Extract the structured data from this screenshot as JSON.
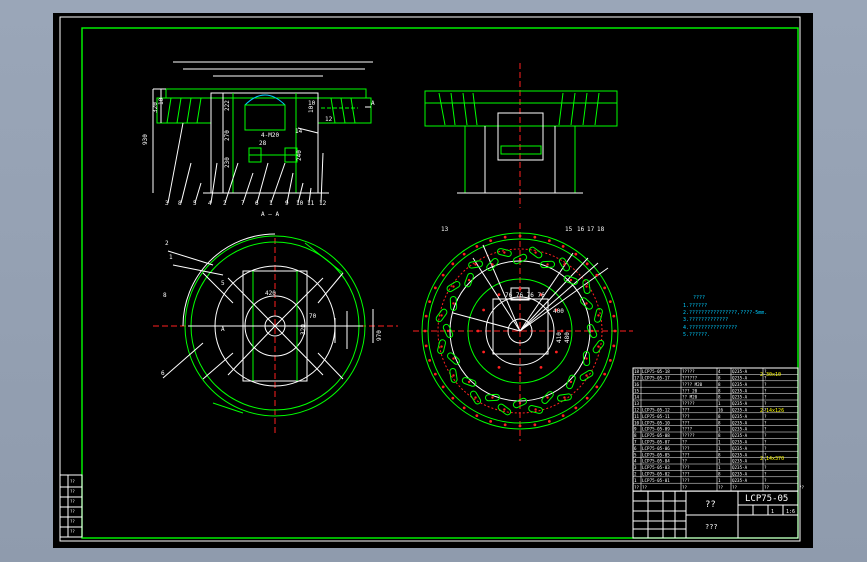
{
  "colors": {
    "canvas": "#000000",
    "viewport": "#96a2b4",
    "frame": "#ffffff",
    "border": "#00ff00",
    "part": "#ffffff",
    "green": "#00ff00",
    "red": "#ff2020",
    "cyan": "#00ccff",
    "yellow": "#ffff00",
    "magenta": "#ff00ff"
  },
  "section_views": {
    "section_label": "A – A",
    "cut_mark_left": "A",
    "cut_mark_right": "A",
    "dims": {
      "overall_height": "930",
      "top_band": "320",
      "upper_offset": "10",
      "inner_height": "222",
      "side_a": "270",
      "side_b": "230",
      "center": "240",
      "small_left": "10",
      "small_right": "12",
      "small_top": "10",
      "ring_mark": "14",
      "pin_mark": "28",
      "weld_sym": "4-M20"
    },
    "balloons_bottom": [
      "3",
      "8",
      "5",
      "4",
      "2",
      "7",
      "6",
      "1",
      "9",
      "10",
      "11",
      "12"
    ]
  },
  "plan_views": {
    "left": {
      "balloons": [
        "2",
        "1",
        "5",
        "8",
        "6"
      ],
      "dims": {
        "width": "420",
        "height": "970",
        "d1": "320",
        "d2": "70",
        "cut": "A"
      }
    },
    "right": {
      "top_labels": [
        "13",
        "15",
        "16",
        "17",
        "18"
      ],
      "dims": {
        "center_row": "76 76 76 76",
        "d_a": "410",
        "d_b": "480",
        "d_c": "400"
      }
    }
  },
  "notes": {
    "title": "????",
    "lines": [
      "1.??????",
      "2.????????????????,????-5mm.",
      "3.?????????????",
      "4.????????????????",
      "5.??????."
    ]
  },
  "parts_list": {
    "rows": [
      {
        "no": "18",
        "code": "LCP75-05-18",
        "name": "?????",
        "qty": "4",
        "mat": "Q235-A",
        "note": "?"
      },
      {
        "no": "17",
        "code": "LCP75-05-17",
        "name": "??????",
        "qty": "8",
        "mat": "Q235-A",
        "note": "?"
      },
      {
        "no": "16",
        "code": "",
        "name": "???? M20",
        "qty": "8",
        "mat": "Q235-A",
        "note": "?"
      },
      {
        "no": "15",
        "code": "",
        "name": "??? 20",
        "qty": "8",
        "mat": "Q235-A",
        "note": "?"
      },
      {
        "no": "14",
        "code": "",
        "name": "?? M20",
        "qty": "8",
        "mat": "Q235-A",
        "note": "?"
      },
      {
        "no": "13",
        "code": "",
        "name": "?????",
        "qty": "1",
        "mat": "Q235-A",
        "note": "?"
      },
      {
        "no": "12",
        "code": "LCP75-05-12",
        "name": "???",
        "qty": "16",
        "mat": "Q235-A",
        "note": "?"
      },
      {
        "no": "11",
        "code": "LCP75-05-11",
        "name": "???",
        "qty": "8",
        "mat": "Q235-A",
        "note": "?"
      },
      {
        "no": "10",
        "code": "LCP75-05-10",
        "name": "???",
        "qty": "8",
        "mat": "Q235-A",
        "note": "?"
      },
      {
        "no": "9",
        "code": "LCP75-05-09",
        "name": "????",
        "qty": "1",
        "mat": "Q235-A",
        "note": "?"
      },
      {
        "no": "8",
        "code": "LCP75-05-08",
        "name": "?????",
        "qty": "8",
        "mat": "Q235-A",
        "note": "?"
      },
      {
        "no": "7",
        "code": "LCP75-05-07",
        "name": "??",
        "qty": "1",
        "mat": "Q235-A",
        "note": "?"
      },
      {
        "no": "6",
        "code": "LCP75-05-06",
        "name": "???",
        "qty": "1",
        "mat": "Q235-A",
        "note": "?"
      },
      {
        "no": "5",
        "code": "LCP75-05-05",
        "name": "???",
        "qty": "8",
        "mat": "Q235-A",
        "note": "?"
      },
      {
        "no": "4",
        "code": "LCP75-05-04",
        "name": "??",
        "qty": "1",
        "mat": "Q235-A",
        "note": "?"
      },
      {
        "no": "3",
        "code": "LCP75-05-03",
        "name": "???",
        "qty": "1",
        "mat": "Q235-A",
        "note": "?"
      },
      {
        "no": "2",
        "code": "LCP75-05-02",
        "name": "???",
        "qty": "8",
        "mat": "Q235-A",
        "note": "?"
      },
      {
        "no": "1",
        "code": "LCP75-05-01",
        "name": "???",
        "qty": "1",
        "mat": "Q235-A",
        "note": "?"
      }
    ],
    "right_marks": [
      "2-30x10",
      "2-14x126",
      "2-14x370"
    ],
    "header": [
      "??",
      "??",
      "??",
      "??",
      "??",
      "??",
      "??"
    ]
  },
  "title_block": {
    "name": "??",
    "drawing_no": "LCP75-05",
    "company": "???",
    "scale": "1:6",
    "sheet": "1"
  },
  "left_strip": [
    "??",
    "??",
    "??",
    "??",
    "??",
    "??"
  ]
}
